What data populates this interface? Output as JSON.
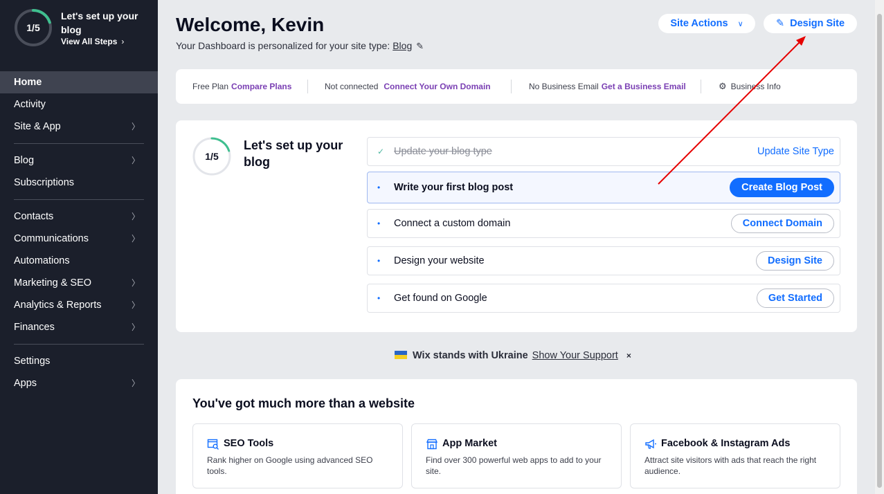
{
  "sidebar": {
    "progress_label": "1/5",
    "progress_fraction": 0.2,
    "title": "Let's set up your blog",
    "view_steps": "View All Steps",
    "nav": [
      {
        "label": "Home",
        "active": true,
        "has_arrow": false
      },
      {
        "label": "Activity",
        "has_arrow": false
      },
      {
        "label": "Site & App",
        "has_arrow": true
      },
      {
        "sep": true
      },
      {
        "label": "Blog",
        "has_arrow": true
      },
      {
        "label": "Subscriptions",
        "has_arrow": false
      },
      {
        "sep": true
      },
      {
        "label": "Contacts",
        "has_arrow": true
      },
      {
        "label": "Communications",
        "has_arrow": true
      },
      {
        "label": "Automations",
        "has_arrow": false
      },
      {
        "label": "Marketing & SEO",
        "has_arrow": true
      },
      {
        "label": "Analytics & Reports",
        "has_arrow": true
      },
      {
        "label": "Finances",
        "has_arrow": true
      },
      {
        "sep": true
      },
      {
        "label": "Settings",
        "has_arrow": false
      },
      {
        "label": "Apps",
        "has_arrow": true
      }
    ]
  },
  "header": {
    "welcome": "Welcome, Kevin",
    "subtitle": "Your Dashboard is personalized for your site type:",
    "site_type": "Blog",
    "site_actions": "Site Actions",
    "design_site": "Design Site"
  },
  "plan_bar": {
    "plan": "Free Plan",
    "compare_plans": "Compare Plans",
    "domain_status": "Not connected",
    "connect_domain": "Connect Your Own Domain",
    "email_status": "No Business Email",
    "get_email": "Get a Business Email",
    "business_info": "Business Info"
  },
  "setup": {
    "progress_label": "1/5",
    "progress_fraction": 0.2,
    "title": "Let's set up your blog",
    "steps": [
      {
        "text": "Update your blog type",
        "done": true,
        "action": "Update Site Type"
      },
      {
        "text": "Write your first blog post",
        "current": true,
        "action": "Create Blog Post"
      },
      {
        "text": "Connect a custom domain",
        "action": "Connect Domain"
      },
      {
        "text": "Design your website",
        "action": "Design Site"
      },
      {
        "text": "Get found on Google",
        "action": "Get Started"
      }
    ]
  },
  "ukraine": {
    "text": "Wix stands with Ukraine",
    "link": "Show Your Support",
    "close": "×"
  },
  "more": {
    "title": "You've got much more than a website",
    "tools": [
      {
        "name": "SEO Tools",
        "icon": "seo-icon",
        "desc": "Rank higher on Google using advanced SEO tools."
      },
      {
        "name": "App Market",
        "icon": "store-icon",
        "desc": "Find over 300 powerful web apps to add to your site."
      },
      {
        "name": "Facebook & Instagram Ads",
        "icon": "megaphone-icon",
        "desc": "Attract site visitors with ads that reach the right audience."
      }
    ]
  },
  "colors": {
    "accent": "#116dff",
    "sidebar_bg": "#1b1f2b",
    "progress_green": "#3fbf8f",
    "annotation": "#e60000"
  }
}
